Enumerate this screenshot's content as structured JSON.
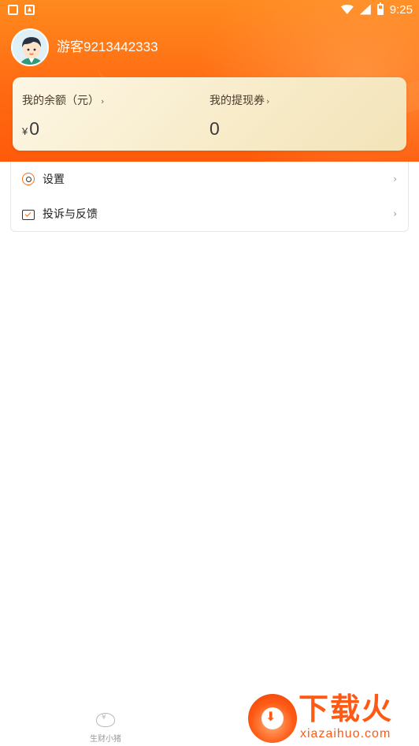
{
  "status_bar": {
    "time": "9:25",
    "left_icons": [
      "shield-notification-icon",
      "font-notification-icon"
    ],
    "right_icons": [
      "wifi-icon",
      "cell-signal-icon",
      "battery-icon"
    ]
  },
  "profile": {
    "username": "游客9213442333",
    "avatar_icon": "cartoon-boy-avatar"
  },
  "wallet": {
    "balance_label": "我的余额（元）",
    "balance_chevron": "›",
    "balance_currency": "¥",
    "balance_value": "0",
    "voucher_label": "我的提现券",
    "voucher_chevron": "›",
    "voucher_value": "0"
  },
  "menu": {
    "items": [
      {
        "label": "设置",
        "icon": "settings-icon",
        "chevron": "›"
      },
      {
        "label": "投诉与反馈",
        "icon": "feedback-icon",
        "chevron": "›"
      }
    ]
  },
  "tab_bar": {
    "tabs": [
      {
        "label": "生财小猪",
        "icon": "piggy-bank-icon"
      }
    ]
  },
  "watermark": {
    "title": "下载火",
    "subtitle": "xiazaihuo.com"
  },
  "colors": {
    "header_orange": "#ff6a12",
    "card_cream": "#f7ebc8",
    "watermark_orange": "#ff5a14"
  }
}
